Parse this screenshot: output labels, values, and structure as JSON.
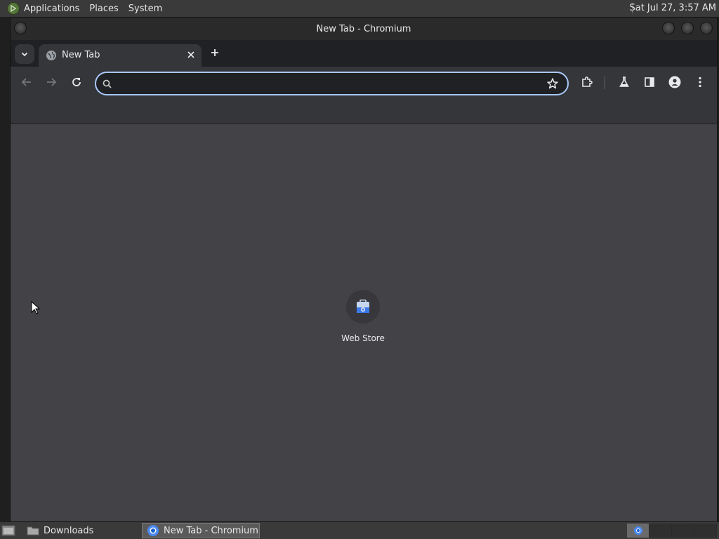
{
  "top_panel": {
    "menus": [
      "Applications",
      "Places",
      "System"
    ],
    "clock": "Sat Jul 27,  3:57 AM"
  },
  "window": {
    "title": "New Tab - Chromium"
  },
  "tabs": [
    {
      "title": "New Tab",
      "active": true
    }
  ],
  "toolbar": {
    "omnibox_value": "",
    "icons": [
      "back-icon",
      "forward-icon",
      "reload-icon",
      "bookmark-star-icon",
      "extensions-icon",
      "labs-flask-icon",
      "side-panel-icon",
      "profile-icon",
      "menu-icon"
    ]
  },
  "shortcuts": [
    {
      "label": "Web Store",
      "icon": "web-store-icon"
    }
  ],
  "taskbar": {
    "tasks": [
      {
        "label": "Downloads",
        "icon": "folder-icon",
        "active": false
      },
      {
        "label": "New Tab - Chromium",
        "icon": "chromium-icon",
        "active": true
      }
    ],
    "workspaces": 4,
    "current_workspace": 1
  },
  "colors": {
    "panel": "#3a3a3a",
    "tab_active": "#35363a",
    "content": "#434347",
    "omnibox_focus": "#a8c7fa"
  }
}
